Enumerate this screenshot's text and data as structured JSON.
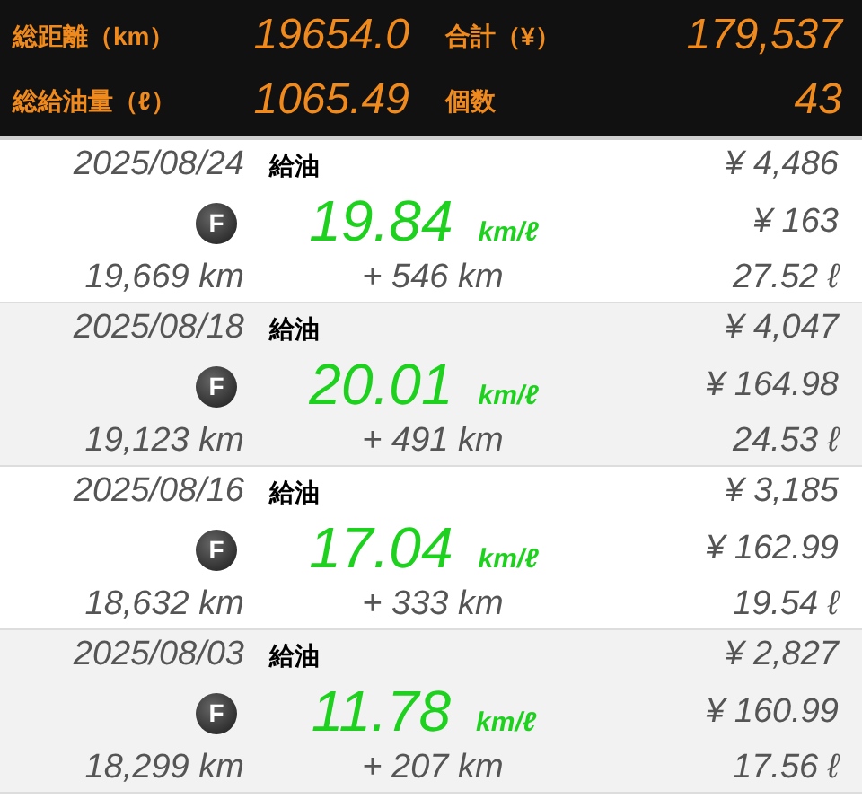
{
  "summary": [
    {
      "label": "総距離（km）",
      "value": "19654.0"
    },
    {
      "label": "合計（¥）",
      "value": "179,537"
    },
    {
      "label": "総給油量（ℓ）",
      "value": "1065.49"
    },
    {
      "label": "個数",
      "value": "43"
    }
  ],
  "entries": [
    {
      "date": "2025/08/24",
      "type": "給油",
      "badge": "F",
      "efficiency": "19.84",
      "unit": "km/ℓ",
      "odometer": "19,669 km",
      "distance": "+ 546 km",
      "total": "¥ 4,486",
      "unit_price": "¥ 163",
      "volume": "27.52 ℓ",
      "selected": false
    },
    {
      "date": "2025/08/18",
      "type": "給油",
      "badge": "F",
      "efficiency": "20.01",
      "unit": "km/ℓ",
      "odometer": "19,123 km",
      "distance": "+ 491 km",
      "total": "¥ 4,047",
      "unit_price": "¥ 164.98",
      "volume": "24.53 ℓ",
      "selected": true
    },
    {
      "date": "2025/08/16",
      "type": "給油",
      "badge": "F",
      "efficiency": "17.04",
      "unit": "km/ℓ",
      "odometer": "18,632 km",
      "distance": "+ 333 km",
      "total": "¥ 3,185",
      "unit_price": "¥ 162.99",
      "volume": "19.54 ℓ",
      "selected": false
    },
    {
      "date": "2025/08/03",
      "type": "給油",
      "badge": "F",
      "efficiency": "11.78",
      "unit": "km/ℓ",
      "odometer": "18,299 km",
      "distance": "+ 207 km",
      "total": "¥ 2,827",
      "unit_price": "¥ 160.99",
      "volume": "17.56 ℓ",
      "selected": true
    }
  ]
}
